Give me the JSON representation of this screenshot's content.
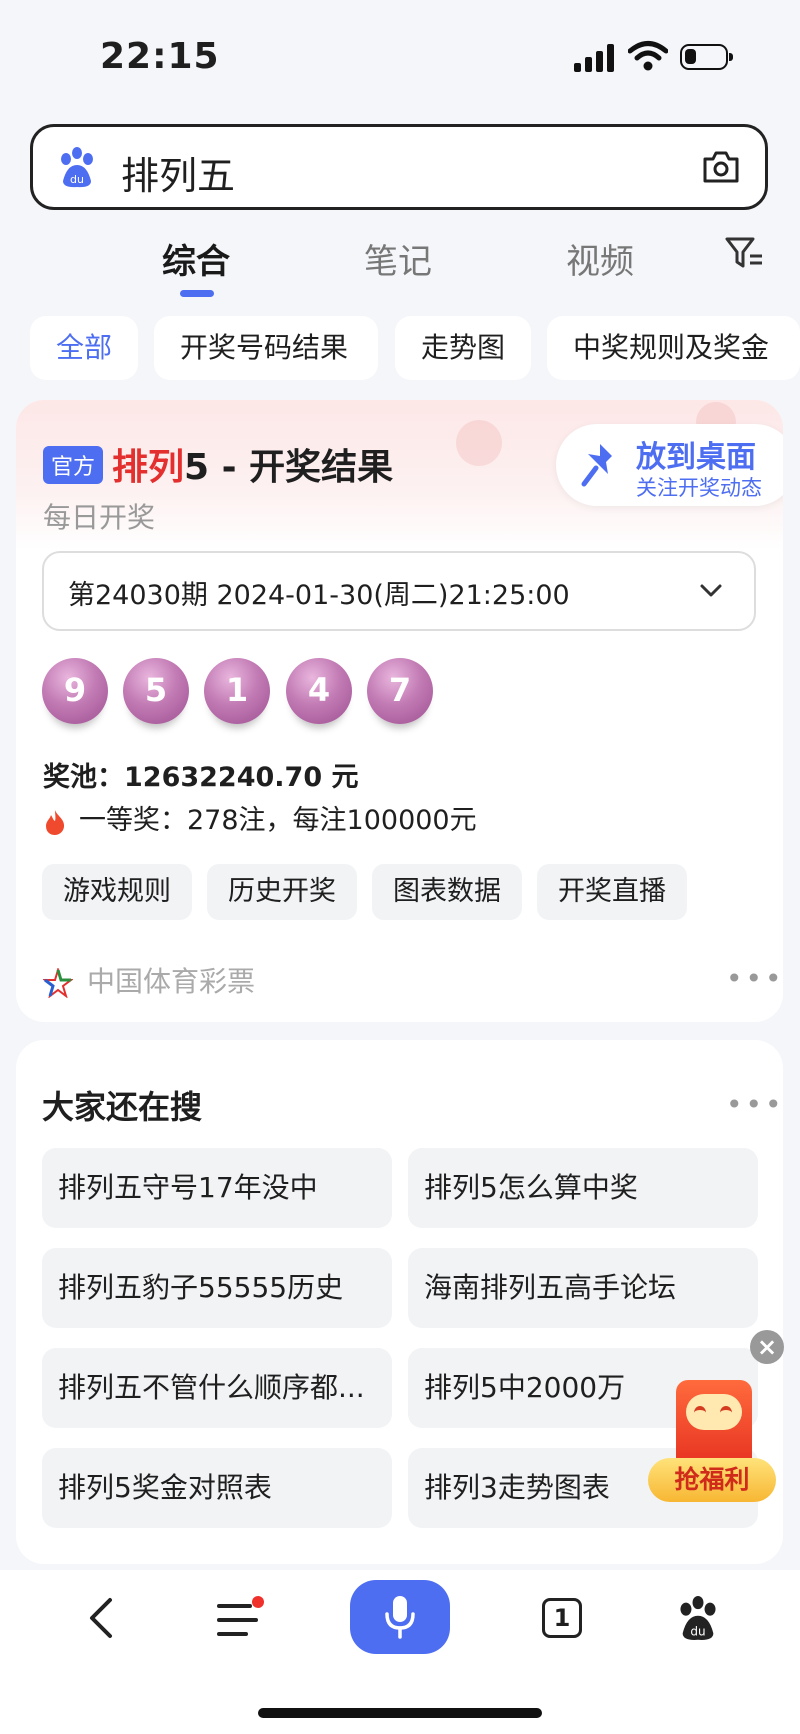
{
  "status": {
    "time": "22:15"
  },
  "search": {
    "query": "排列五"
  },
  "tabs": [
    "综合",
    "笔记",
    "视频"
  ],
  "chips": [
    "全部",
    "开奖号码结果",
    "走势图",
    "中奖规则及奖金"
  ],
  "result": {
    "badge": "官方",
    "title_highlight": "排列",
    "title_rest": "5 - 开奖结果",
    "subtitle": "每日开奖",
    "pin_title": "放到桌面",
    "pin_subtitle": "关注开奖动态",
    "draw_select": "第24030期 2024-01-30(周二)21:25:00",
    "numbers": [
      "9",
      "5",
      "1",
      "4",
      "7"
    ],
    "pool_label": "奖池：",
    "pool_value": "12632240.70 元",
    "prize_text": "一等奖：278注，每注100000元",
    "buttons": [
      "游戏规则",
      "历史开奖",
      "图表数据",
      "开奖直播"
    ],
    "source": "中国体育彩票",
    "more": "•••"
  },
  "related": {
    "title": "大家还在搜",
    "more": "•••",
    "items": [
      "排列五守号17年没中",
      "排列5怎么算中奖",
      "排列五豹子55555历史",
      "海南排列五高手论坛",
      "排列五不管什么顺序都...",
      "排列5中2000万",
      "排列5奖金对照表",
      "排列3走势图表"
    ]
  },
  "ad": {
    "label": "抢福利",
    "close": "×"
  },
  "bottom_nav": {
    "tab_count": "1"
  },
  "colors": {
    "accent": "#4e6ef2",
    "red": "#e3302f",
    "ball": "#b266a8"
  }
}
